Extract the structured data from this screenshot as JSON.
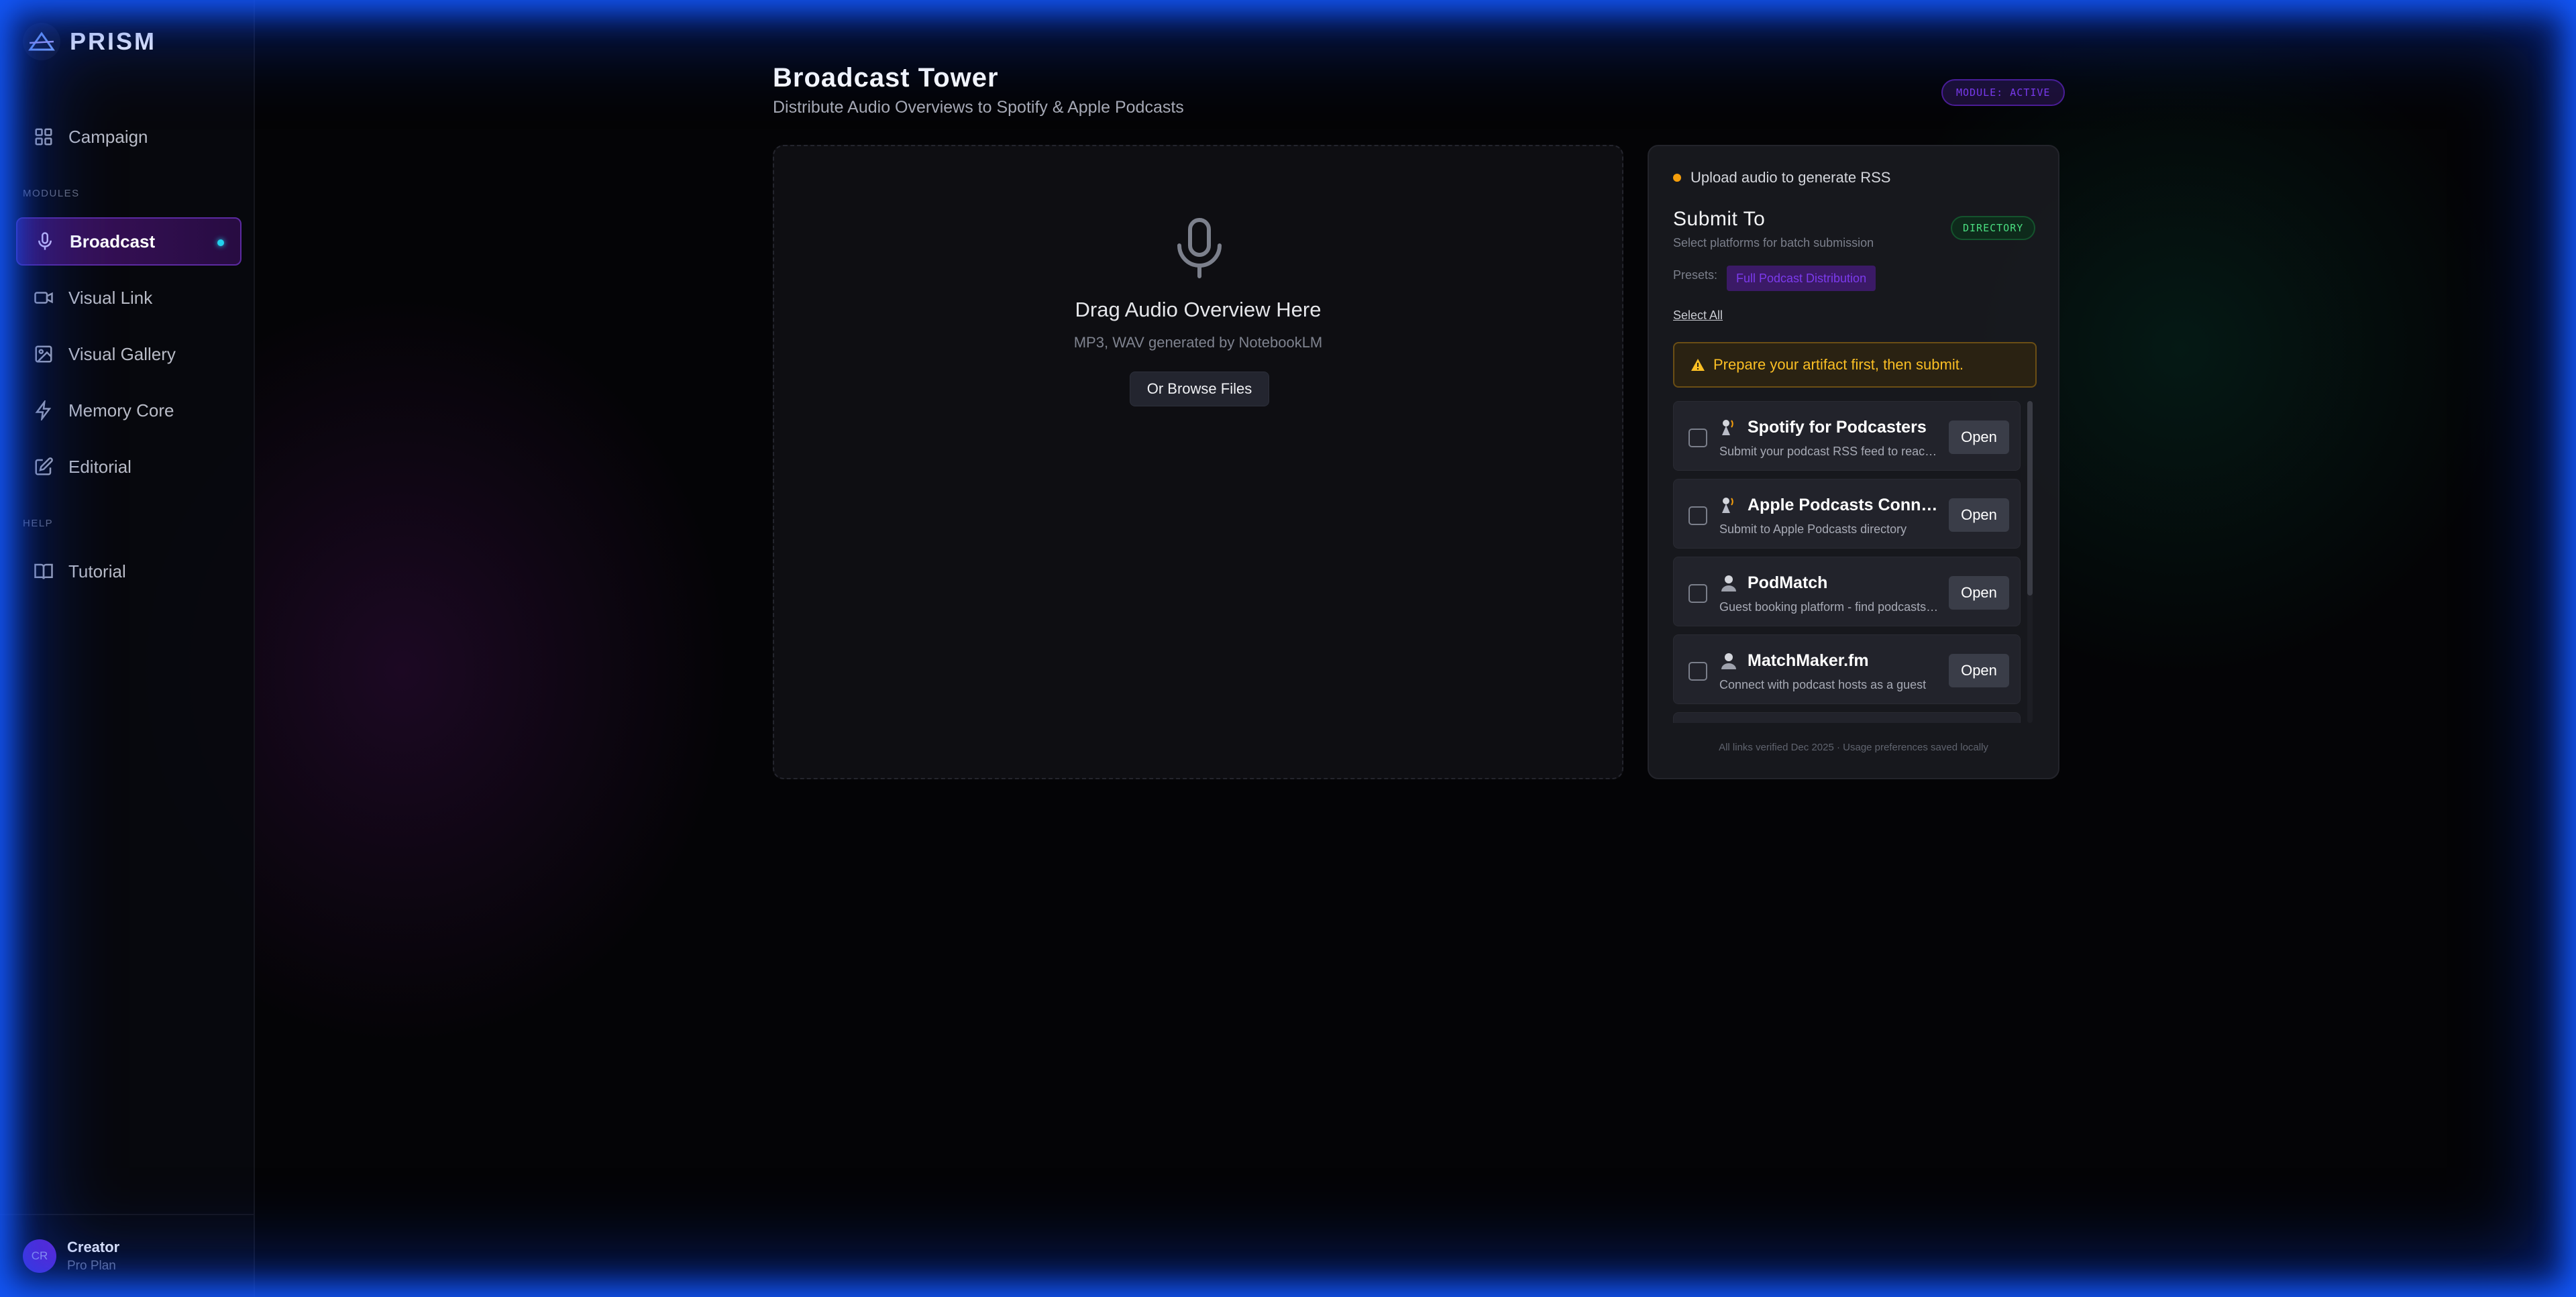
{
  "brand": {
    "name": "PRISM"
  },
  "sidebar": {
    "campaign_label": "Campaign",
    "section_modules": "MODULES",
    "section_help": "HELP",
    "items": [
      {
        "label": "Broadcast",
        "icon": "mic-icon",
        "active": true
      },
      {
        "label": "Visual Link",
        "icon": "video-icon"
      },
      {
        "label": "Visual Gallery",
        "icon": "image-icon"
      },
      {
        "label": "Memory Core",
        "icon": "bolt-icon"
      },
      {
        "label": "Editorial",
        "icon": "edit-icon"
      }
    ],
    "tutorial_label": "Tutorial"
  },
  "user": {
    "initials": "CR",
    "name": "Creator",
    "plan": "Pro Plan"
  },
  "header": {
    "title": "Broadcast Tower",
    "subtitle": "Distribute Audio Overviews to Spotify & Apple Podcasts",
    "module_badge": "MODULE: ACTIVE"
  },
  "dropzone": {
    "title": "Drag Audio Overview Here",
    "subtitle": "MP3, WAV generated by NotebookLM",
    "browse_label": "Or Browse Files"
  },
  "panel": {
    "rss_status": "Upload audio to generate RSS",
    "submit_title": "Submit To",
    "submit_subtitle": "Select platforms for batch submission",
    "directory_badge": "DIRECTORY",
    "presets_label": "Presets:",
    "preset_chip": "Full Podcast Distribution",
    "select_all": "Select All",
    "warning": "Prepare your artifact first, then submit.",
    "open_label": "Open",
    "platforms": [
      {
        "name": "Spotify for Podcasters",
        "desc": "Submit your podcast RSS feed to reach Spotify listeners"
      },
      {
        "name": "Apple Podcasts Connect",
        "desc": "Submit to Apple Podcasts directory"
      },
      {
        "name": "PodMatch",
        "desc": "Guest booking platform - find podcasts to appear on"
      },
      {
        "name": "MatchMaker.fm",
        "desc": "Connect with podcast hosts as a guest"
      }
    ],
    "footer": "All links verified Dec 2025 · Usage preferences saved locally"
  },
  "colors": {
    "accent_purple": "#7c3aed",
    "active_dot": "#22d3ee",
    "warning": "#fbbf24",
    "directory_green": "#4ade80",
    "frame_glow": "#1450ff"
  }
}
